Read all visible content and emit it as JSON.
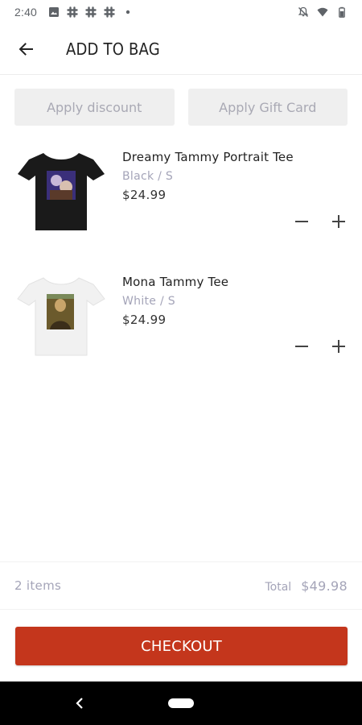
{
  "status_bar": {
    "time": "2:40",
    "left_icons": [
      "image-icon",
      "slack-icon",
      "slack-icon",
      "slack-icon",
      "dot-icon"
    ],
    "right_icons": [
      "mute-icon",
      "wifi-icon",
      "battery-icon"
    ]
  },
  "app_bar": {
    "title": "ADD TO BAG",
    "back_icon": "arrow-left-icon"
  },
  "actions": {
    "discount_label": "Apply discount",
    "gift_card_label": "Apply Gift Card"
  },
  "cart": {
    "items": [
      {
        "name": "Dreamy Tammy Portrait Tee",
        "variant": "Black / S",
        "price": "$24.99",
        "shirt_color": "#1a1a1a"
      },
      {
        "name": "Mona Tammy Tee",
        "variant": "White / S",
        "price": "$24.99",
        "shirt_color": "#f1f1f1"
      }
    ]
  },
  "summary": {
    "items_count": "2 items",
    "total_label": "Total",
    "total_value": "$49.98"
  },
  "checkout": {
    "label": "CHECKOUT",
    "color": "#c4361c"
  },
  "colors": {
    "muted_text": "#a4a4b8",
    "button_bg": "#efefef"
  }
}
